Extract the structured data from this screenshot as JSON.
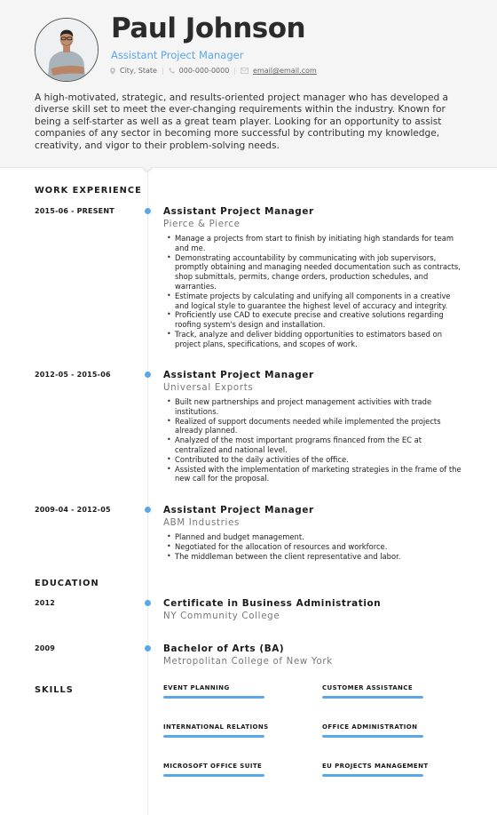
{
  "header": {
    "name": "Paul Johnson",
    "title": "Assistant Project Manager",
    "contact": {
      "location_icon": "map-pin-icon",
      "location": "City, State",
      "phone_icon": "phone-icon",
      "phone": "000-000-0000",
      "email_icon": "envelope-icon",
      "email": "email@email.com",
      "separator": "|"
    },
    "summary": "A high-motivated, strategic, and results-oriented project manager who has developed a diverse skill set to meet the ever-changing requirements within the industry. Known for being a self-starter as well as a great team player. Looking for an opportunity to assist companies of any sector in becoming more successful by contributing my knowledge, creativity, and vigor to their problem-solving needs."
  },
  "colors": {
    "accent": "#5aa7ea",
    "header_bg": "#f5f5f5",
    "text": "#222222"
  },
  "work_experience": {
    "heading": "WORK EXPERIENCE",
    "items": [
      {
        "dates": "2015-06 - PRESENT",
        "title": "Assistant Project Manager",
        "company": "Pierce & Pierce",
        "bullets": [
          "Manage a projects from start to finish by initiating high standards for team and me.",
          "Demonstrating accountability by communicating with job supervisors, promptly obtaining and managing needed documentation such as contracts, shop submittals, permits, change orders, production schedules, and warranties.",
          "Estimate projects by calculating and unifying all components in a creative and logical style to guarantee the highest level of accuracy and integrity.",
          "Proficiently use CAD to execute precise and creative solutions regarding roofing system's design and installation.",
          "Track, analyze and deliver bidding opportunities to estimators based on project plans, specifications, and scopes of work."
        ]
      },
      {
        "dates": "2012-05 - 2015-06",
        "title": "Assistant Project Manager",
        "company": "Universal Exports",
        "bullets": [
          "Built new partnerships and project management activities with trade institutions.",
          "Realized of support documents needed while implemented the projects already planned.",
          "Analyzed of the most important programs financed from the EC at centralized and national level.",
          "Contributed to the daily activities of the office.",
          "Assisted with the implementation of marketing strategies in the frame of the new call for the proposal."
        ]
      },
      {
        "dates": "2009-04 - 2012-05",
        "title": "Assistant Project Manager",
        "company": "ABM Industries",
        "bullets": [
          "Planned and budget management.",
          "Negotiated for the allocation of resources and workforce.",
          "The middleman between the client representative and labor."
        ]
      }
    ]
  },
  "education": {
    "heading": "EDUCATION",
    "items": [
      {
        "year": "2012",
        "degree": "Certificate in Business Administration",
        "school": "NY Community College"
      },
      {
        "year": "2009",
        "degree": "Bachelor of Arts (BA)",
        "school": "Metropolitan College of New York"
      }
    ]
  },
  "skills": {
    "heading": "SKILLS",
    "items": [
      {
        "name": "EVENT PLANNING",
        "level_percent": 100
      },
      {
        "name": "CUSTOMER ASSISTANCE",
        "level_percent": 100
      },
      {
        "name": "INTERNATIONAL RELATIONS",
        "level_percent": 100
      },
      {
        "name": "OFFICE ADMINISTRATION",
        "level_percent": 100
      },
      {
        "name": "MICROSOFT OFFICE SUITE",
        "level_percent": 100
      },
      {
        "name": "EU PROJECTS MANAGEMENT",
        "level_percent": 100
      }
    ]
  }
}
